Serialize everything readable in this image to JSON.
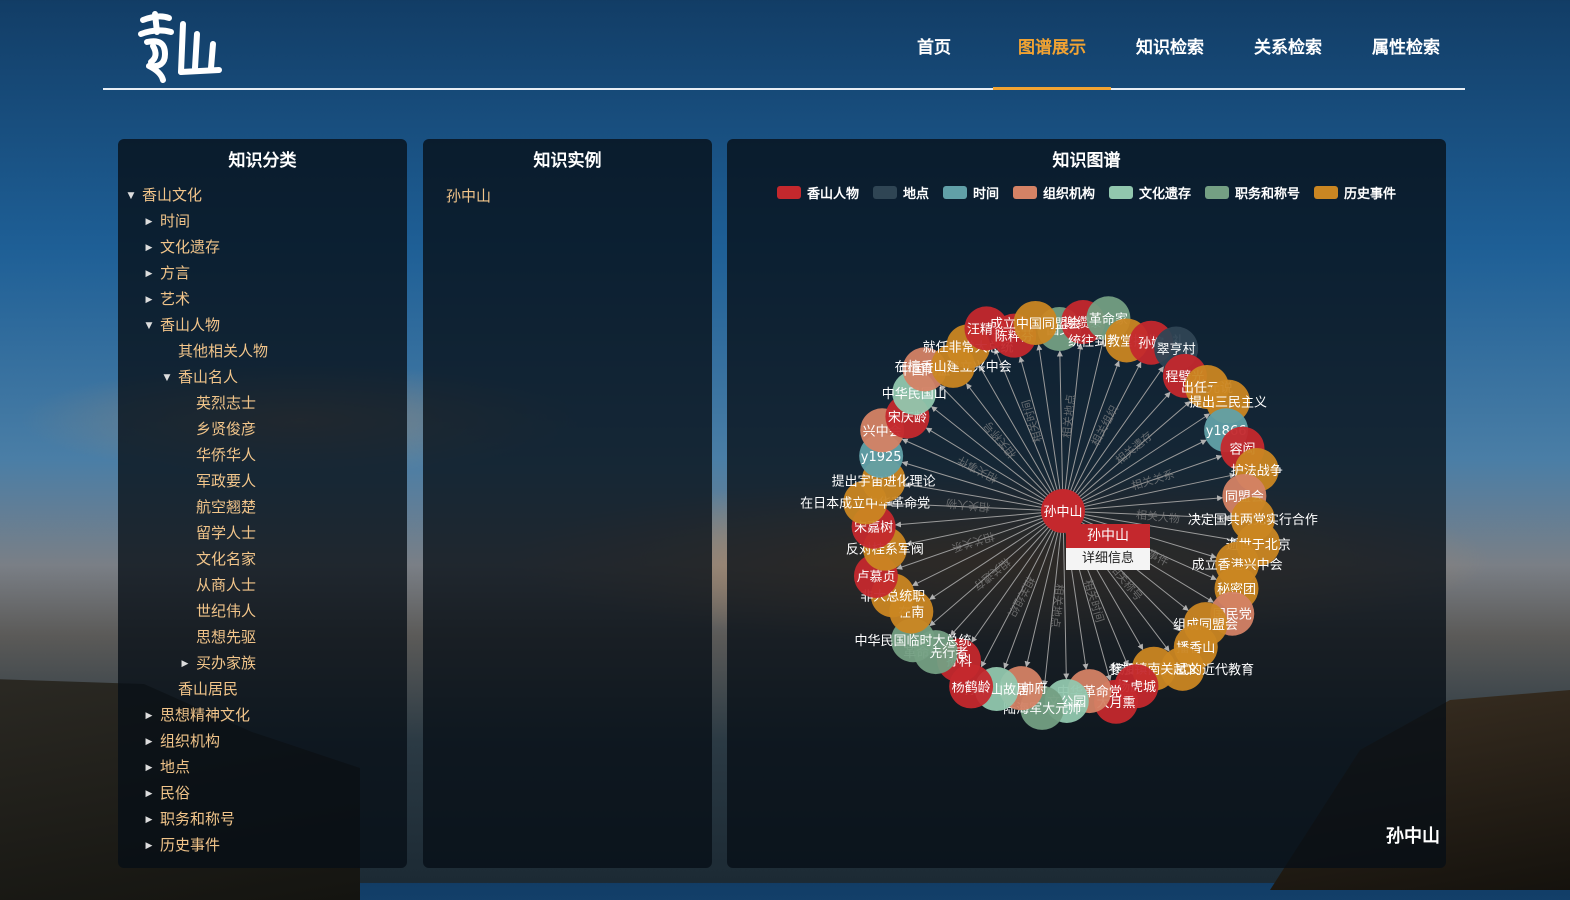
{
  "header": {
    "logo_text": "香山",
    "nav": [
      {
        "label": "首页",
        "active": false
      },
      {
        "label": "图谱展示",
        "active": true
      },
      {
        "label": "知识检索",
        "active": false
      },
      {
        "label": "关系检索",
        "active": false
      },
      {
        "label": "属性检索",
        "active": false
      }
    ]
  },
  "category_panel": {
    "title": "知识分类",
    "tree": [
      {
        "label": "香山文化",
        "level": 0,
        "state": "open"
      },
      {
        "label": "时间",
        "level": 1,
        "state": "closed"
      },
      {
        "label": "文化遗存",
        "level": 1,
        "state": "closed"
      },
      {
        "label": "方言",
        "level": 1,
        "state": "closed"
      },
      {
        "label": "艺术",
        "level": 1,
        "state": "closed"
      },
      {
        "label": "香山人物",
        "level": 1,
        "state": "open"
      },
      {
        "label": "其他相关人物",
        "level": 2,
        "state": "leaf"
      },
      {
        "label": "香山名人",
        "level": 2,
        "state": "open"
      },
      {
        "label": "英烈志士",
        "level": 3,
        "state": "leaf"
      },
      {
        "label": "乡贤俊彦",
        "level": 3,
        "state": "leaf"
      },
      {
        "label": "华侨华人",
        "level": 3,
        "state": "leaf"
      },
      {
        "label": "军政要人",
        "level": 3,
        "state": "leaf"
      },
      {
        "label": "航空翘楚",
        "level": 3,
        "state": "leaf"
      },
      {
        "label": "留学人士",
        "level": 3,
        "state": "leaf"
      },
      {
        "label": "文化名家",
        "level": 3,
        "state": "leaf"
      },
      {
        "label": "从商人士",
        "level": 3,
        "state": "leaf"
      },
      {
        "label": "世纪伟人",
        "level": 3,
        "state": "leaf"
      },
      {
        "label": "思想先驱",
        "level": 3,
        "state": "leaf"
      },
      {
        "label": "买办家族",
        "level": 3,
        "state": "closed"
      },
      {
        "label": "香山居民",
        "level": 2,
        "state": "leaf"
      },
      {
        "label": "思想精神文化",
        "level": 1,
        "state": "closed"
      },
      {
        "label": "组织机构",
        "level": 1,
        "state": "closed"
      },
      {
        "label": "地点",
        "level": 1,
        "state": "closed"
      },
      {
        "label": "民俗",
        "level": 1,
        "state": "closed"
      },
      {
        "label": "职务和称号",
        "level": 1,
        "state": "closed"
      },
      {
        "label": "历史事件",
        "level": 1,
        "state": "closed"
      }
    ]
  },
  "instance_panel": {
    "title": "知识实例",
    "items": [
      "孙中山"
    ]
  },
  "graph_panel": {
    "title": "知识图谱",
    "legend": [
      {
        "label": "香山人物",
        "color": "#c4282d"
      },
      {
        "label": "地点",
        "color": "#2f4554"
      },
      {
        "label": "时间",
        "color": "#61a0a8"
      },
      {
        "label": "组织机构",
        "color": "#d48265"
      },
      {
        "label": "文化遗存",
        "color": "#91c7ae"
      },
      {
        "label": "职务和称号",
        "color": "#749f83"
      },
      {
        "label": "历史事件",
        "color": "#ca8622"
      }
    ],
    "center": {
      "label": "孙中山",
      "category": 0
    },
    "popup": {
      "title": "孙中山",
      "button": "详细信息"
    },
    "footer_label": "孙中山",
    "edge_labels": [
      "相关人物",
      "相关事件",
      "相关称号",
      "相关时间",
      "相关地点",
      "相关组织",
      "相关遗存",
      "相关关系"
    ],
    "nodes": [
      {
        "label": "国父",
        "category": 5
      },
      {
        "label": "谢缵泰",
        "category": 0
      },
      {
        "label": "革命家",
        "category": 5
      },
      {
        "label": "统往到教堂接收洗礼",
        "category": 6
      },
      {
        "label": "孙嫔",
        "category": 0
      },
      {
        "label": "翠亨村",
        "category": 1
      },
      {
        "label": "程璧光",
        "category": 0
      },
      {
        "label": "出任元说",
        "category": 6
      },
      {
        "label": "提出三民主义",
        "category": 6
      },
      {
        "label": "y1866",
        "category": 2
      },
      {
        "label": "容闳",
        "category": 0
      },
      {
        "label": "护法战争",
        "category": 6
      },
      {
        "label": "同盟会",
        "category": 3
      },
      {
        "label": "决定国共两党实行合作",
        "category": 6
      },
      {
        "label": "逝世于北京",
        "category": 6
      },
      {
        "label": "成立香港兴中会",
        "category": 6
      },
      {
        "label": "秘密团",
        "category": 6
      },
      {
        "label": "国民党",
        "category": 3
      },
      {
        "label": "组成同盟会",
        "category": 6
      },
      {
        "label": "播香山",
        "category": 6
      },
      {
        "label": "接受了西方式的近代教育",
        "category": 6
      },
      {
        "label": "参加镇南关起义",
        "category": 6
      },
      {
        "label": "杨虎城",
        "category": 0
      },
      {
        "label": "大月熏",
        "category": 0
      },
      {
        "label": "中华革命党",
        "category": 3
      },
      {
        "label": "文公园",
        "category": 4
      },
      {
        "label": "陆海军大元帅",
        "category": 5
      },
      {
        "label": "大元帅府",
        "category": 3
      },
      {
        "label": "孙中山故居",
        "category": 4
      },
      {
        "label": "杨鹤龄",
        "category": 0
      },
      {
        "label": "孙科",
        "category": 0
      },
      {
        "label": "革命先行者",
        "category": 5
      },
      {
        "label": "中华民国临时大总统",
        "category": 5
      },
      {
        "label": "在南",
        "category": 6
      },
      {
        "label": "非大总统职",
        "category": 6
      },
      {
        "label": "卢慕贞",
        "category": 0
      },
      {
        "label": "反对桂系军阀",
        "category": 6
      },
      {
        "label": "宋嘉树",
        "category": 0
      },
      {
        "label": "在日本成立中华革命党",
        "category": 6
      },
      {
        "label": "提出宇宙进化理论",
        "category": 6
      },
      {
        "label": "y1925",
        "category": 2
      },
      {
        "label": "兴中会",
        "category": 3
      },
      {
        "label": "宋庆龄",
        "category": 0
      },
      {
        "label": "中华民国山",
        "category": 4
      },
      {
        "label": "中国同盟",
        "category": 3
      },
      {
        "label": "在檀香山建立兴中会",
        "category": 6
      },
      {
        "label": "就任非常大总统",
        "category": 6
      },
      {
        "label": "汪精卫",
        "category": 0
      },
      {
        "label": "陈粹芬",
        "category": 0
      },
      {
        "label": "成立中国同盟会",
        "category": 6
      }
    ]
  }
}
